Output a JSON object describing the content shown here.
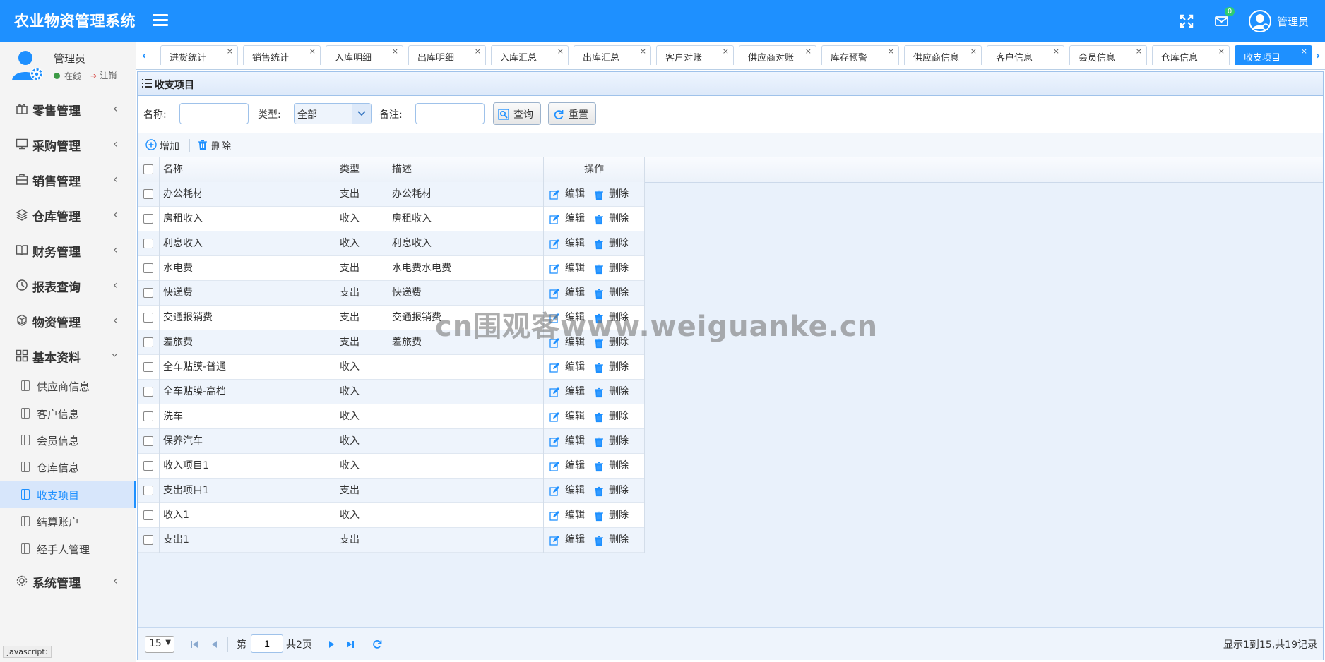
{
  "header": {
    "title": "农业物资管理系统",
    "mail_badge": "0",
    "user_name": "管理员"
  },
  "sidebar": {
    "user_name": "管理员",
    "status": "在线",
    "logout": "注销",
    "menus": [
      {
        "label": "零售管理",
        "icon": "gift-icon"
      },
      {
        "label": "采购管理",
        "icon": "monitor-icon"
      },
      {
        "label": "销售管理",
        "icon": "briefcase-icon"
      },
      {
        "label": "仓库管理",
        "icon": "layers-icon"
      },
      {
        "label": "财务管理",
        "icon": "book-icon"
      },
      {
        "label": "报表查询",
        "icon": "clock-icon"
      },
      {
        "label": "物资管理",
        "icon": "cubes-icon"
      },
      {
        "label": "基本资料",
        "icon": "grid-icon"
      },
      {
        "label": "系统管理",
        "icon": "gear-icon"
      }
    ],
    "sub_items": [
      "供应商信息",
      "客户信息",
      "会员信息",
      "仓库信息",
      "收支项目",
      "结算账户",
      "经手人管理"
    ],
    "status_tip": "javascript:"
  },
  "tabs": [
    "进货统计",
    "销售统计",
    "入库明细",
    "出库明细",
    "入库汇总",
    "出库汇总",
    "客户对账",
    "供应商对账",
    "库存预警",
    "供应商信息",
    "客户信息",
    "会员信息",
    "仓库信息",
    "收支项目"
  ],
  "active_tab": "收支项目",
  "panel": {
    "title": "收支项目"
  },
  "search": {
    "name_label": "名称:",
    "type_label": "类型:",
    "type_value": "全部",
    "remark_label": "备注:",
    "query_button": "查询",
    "reset_button": "重置"
  },
  "toolbar": {
    "add": "增加",
    "delete": "删除"
  },
  "grid": {
    "columns": [
      "名称",
      "类型",
      "描述",
      "操作"
    ],
    "edit_label": "编辑",
    "delete_label": "删除",
    "rows": [
      {
        "name": "办公耗材",
        "type": "支出",
        "desc": "办公耗材"
      },
      {
        "name": "房租收入",
        "type": "收入",
        "desc": "房租收入"
      },
      {
        "name": "利息收入",
        "type": "收入",
        "desc": "利息收入"
      },
      {
        "name": "水电费",
        "type": "支出",
        "desc": "水电费水电费"
      },
      {
        "name": "快递费",
        "type": "支出",
        "desc": "快递费"
      },
      {
        "name": "交通报销费",
        "type": "支出",
        "desc": "交通报销费"
      },
      {
        "name": "差旅费",
        "type": "支出",
        "desc": "差旅费"
      },
      {
        "name": "全车贴膜-普通",
        "type": "收入",
        "desc": ""
      },
      {
        "name": "全车贴膜-高档",
        "type": "收入",
        "desc": ""
      },
      {
        "name": "洗车",
        "type": "收入",
        "desc": ""
      },
      {
        "name": "保养汽车",
        "type": "收入",
        "desc": ""
      },
      {
        "name": "收入项目1",
        "type": "收入",
        "desc": ""
      },
      {
        "name": "支出项目1",
        "type": "支出",
        "desc": ""
      },
      {
        "name": "收入1",
        "type": "收入",
        "desc": ""
      },
      {
        "name": "支出1",
        "type": "支出",
        "desc": ""
      }
    ]
  },
  "pager": {
    "page_size": "15",
    "page_prefix": "第",
    "current_page": "1",
    "page_suffix": "共2页",
    "info": "显示1到15,共19记录"
  },
  "watermark": "cn围观客www.weiguanke.cn",
  "colors": {
    "primary": "#1E90FF",
    "delete_icon": "#1E90FF",
    "online": "#3c9a45"
  }
}
